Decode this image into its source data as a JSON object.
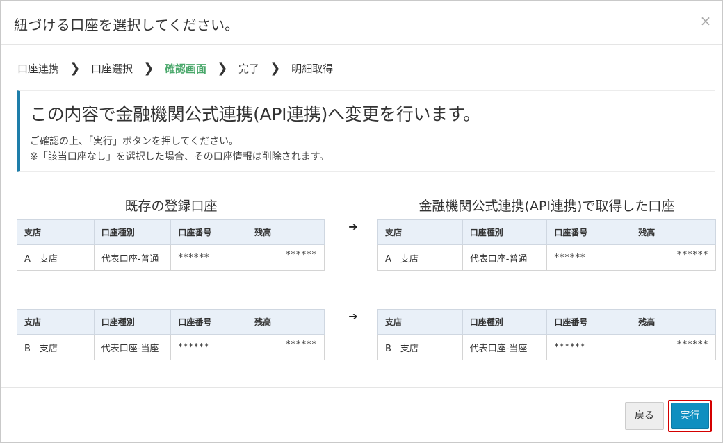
{
  "modal": {
    "title": "紐づける口座を選択してください。",
    "close_label": "×"
  },
  "breadcrumb": {
    "steps": [
      "口座連携",
      "口座選択",
      "確認画面",
      "完了",
      "明細取得"
    ],
    "active_index": 2,
    "separator": "❯"
  },
  "notice": {
    "heading": "この内容で金融機関公式連携(API連携)へ変更を行います。",
    "line1": "ご確認の上、「実行」ボタンを押してください。",
    "line2": "※「該当口座なし」を選択した場合、その口座情報は削除されます。",
    "accent_color": "#1e7eaa"
  },
  "existing": {
    "heading": "既存の登録口座"
  },
  "api": {
    "heading": "金融機関公式連携(API連携)で取得した口座"
  },
  "table_headers": [
    "支店",
    "口座種別",
    "口座番号",
    "残高"
  ],
  "pairs": [
    {
      "left": {
        "branch": "A　支店",
        "type": "代表口座-普通",
        "number": "******",
        "balance": "******"
      },
      "right": {
        "branch": "A　支店",
        "type": "代表口座-普通",
        "number": "******",
        "balance": "******"
      }
    },
    {
      "left": {
        "branch": "B　支店",
        "type": "代表口座-当座",
        "number": "******",
        "balance": "******"
      },
      "right": {
        "branch": "B　支店",
        "type": "代表口座-当座",
        "number": "******",
        "balance": "******"
      }
    }
  ],
  "arrow_glyph": "➔",
  "footer": {
    "back_label": "戻る",
    "execute_label": "実行",
    "execute_color": "#0f8fc0",
    "highlight_color": "#d40000"
  }
}
